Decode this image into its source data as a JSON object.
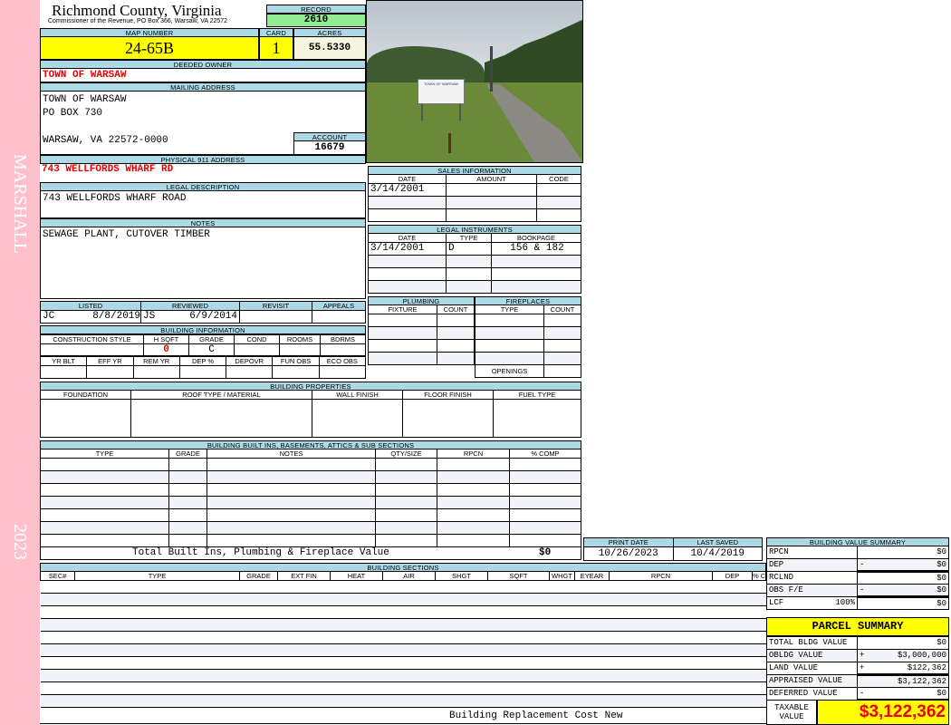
{
  "side": {
    "name": "MARSHALL",
    "year": "2023"
  },
  "header": {
    "county": "Richmond County, Virginia",
    "office": "Commissioner of the Revenue, PO Box 366, Warsaw, VA 22572",
    "record_label": "RECORD",
    "record": "2610"
  },
  "parcel": {
    "map_label": "MAP NUMBER",
    "map": "24-65B",
    "card_label": "CARD",
    "card": "1",
    "acres_label": "ACRES",
    "acres": "55.5330"
  },
  "owner": {
    "label": "DEEDED OWNER",
    "name": "TOWN OF WARSAW"
  },
  "mailing": {
    "label": "MAILING ADDRESS",
    "lines": [
      "TOWN OF WARSAW",
      "PO BOX 730",
      "",
      "WARSAW, VA 22572-0000"
    ],
    "account_label": "ACCOUNT",
    "account": "16679"
  },
  "physical": {
    "label": "PHYSICAL 911 ADDRESS",
    "value": "743 WELLFORDS WHARF RD"
  },
  "legal": {
    "label": "LEGAL DESCRIPTION",
    "value": "743 WELLFORDS WHARF ROAD"
  },
  "notes": {
    "label": "NOTES",
    "value": "SEWAGE PLANT, CUTOVER TIMBER"
  },
  "review": {
    "headers": [
      "LISTED",
      "REVIEWED",
      "REVISIT",
      "APPEALS"
    ],
    "listed_by": "JC",
    "listed_date": "8/8/2019",
    "reviewed_by": "JS",
    "reviewed_date": "6/9/2014"
  },
  "building_info": {
    "title": "BUILDING INFORMATION",
    "headers1": [
      "CONSTRUCTION STYLE",
      "H SQFT",
      "GRADE",
      "COND",
      "ROOMS",
      "BDRMS"
    ],
    "hsqft": "0",
    "grade": "C",
    "headers2": [
      "YR BLT",
      "EFF YR",
      "REM YR",
      "DEP %",
      "DEPOVR",
      "FUN OBS",
      "ECO OBS"
    ]
  },
  "photo": {
    "sign_text": "TOWN OF WARSAW"
  },
  "sales": {
    "title": "SALES INFORMATION",
    "headers": [
      "DATE",
      "AMOUNT",
      "CODE"
    ],
    "rows": [
      [
        "3/14/2001",
        "",
        ""
      ],
      [
        "",
        "",
        ""
      ],
      [
        "",
        "",
        ""
      ]
    ]
  },
  "instruments": {
    "title": "LEGAL INSTRUMENTS",
    "headers": [
      "DATE",
      "TYPE",
      "BOOKPAGE"
    ],
    "rows": [
      [
        "3/14/2001",
        "D",
        "156 & 182"
      ],
      [
        "",
        "",
        ""
      ],
      [
        "",
        "",
        ""
      ],
      [
        "",
        "",
        ""
      ]
    ]
  },
  "plumbing": {
    "title": "PLUMBING",
    "headers": [
      "FIXTURE",
      "COUNT"
    ]
  },
  "fireplaces": {
    "title": "FIREPLACES",
    "headers": [
      "TYPE",
      "COUNT"
    ],
    "openings": "OPENINGS"
  },
  "properties": {
    "title": "BUILDING PROPERTIES",
    "headers": [
      "FOUNDATION",
      "ROOF TYPE / MATERIAL",
      "WALL FINISH",
      "FLOOR FINISH",
      "FUEL TYPE"
    ]
  },
  "builtins": {
    "title": "BUILDING BUILT INS, BASEMENTS, ATTICS & SUB SECTIONS",
    "headers": [
      "TYPE",
      "GRADE",
      "NOTES",
      "QTY/SIZE",
      "RPCN",
      "% COMP"
    ],
    "total_label": "Total Built Ins, Plumbing & Fireplace Value",
    "total": "$0"
  },
  "dates": {
    "print_label": "PRINT DATE",
    "print": "10/26/2023",
    "saved_label": "LAST SAVED",
    "saved": "10/4/2019"
  },
  "sections": {
    "title": "BUILDING SECTIONS",
    "headers": [
      "SEC#",
      "TYPE",
      "GRADE",
      "EXT FIN",
      "HEAT",
      "AIR",
      "SHGT",
      "SQFT",
      "WHGT",
      "EYEAR",
      "RPCN",
      "DEP",
      "% COMP"
    ],
    "footer": "Building Replacement Cost New"
  },
  "bvs": {
    "title": "BUILDING VALUE SUMMARY",
    "rows": [
      {
        "label": "RPCN",
        "op": "",
        "value": "$0"
      },
      {
        "label": "DEP",
        "op": "-",
        "value": "$0"
      },
      {
        "label": "RCLND",
        "op": "",
        "value": "$0"
      },
      {
        "label": "OBS F/E",
        "op": "-",
        "value": "$0"
      },
      {
        "label": "LCF",
        "pct": "100%",
        "op": "",
        "value": "$0"
      }
    ]
  },
  "summary": {
    "title": "PARCEL SUMMARY",
    "rows": [
      {
        "label": "TOTAL BLDG VALUE",
        "op": "",
        "value": "$0"
      },
      {
        "label": "OBLDG VALUE",
        "op": "+",
        "value": "$3,000,000"
      },
      {
        "label": "LAND VALUE",
        "op": "+",
        "value": "$122,362"
      },
      {
        "label": "APPRAISED VALUE",
        "op": "",
        "value": "$3,122,362"
      },
      {
        "label": "DEFERRED VALUE",
        "op": "-",
        "value": "$0"
      }
    ],
    "taxable_label": "TAXABLE VALUE",
    "taxable": "$3,122,362"
  },
  "colors": {
    "label_bg": "#add8e6",
    "highlight": "#ffff00",
    "record_bg": "#90ee90",
    "sidebar": "#ffc0cb",
    "alert": "#e00000"
  }
}
